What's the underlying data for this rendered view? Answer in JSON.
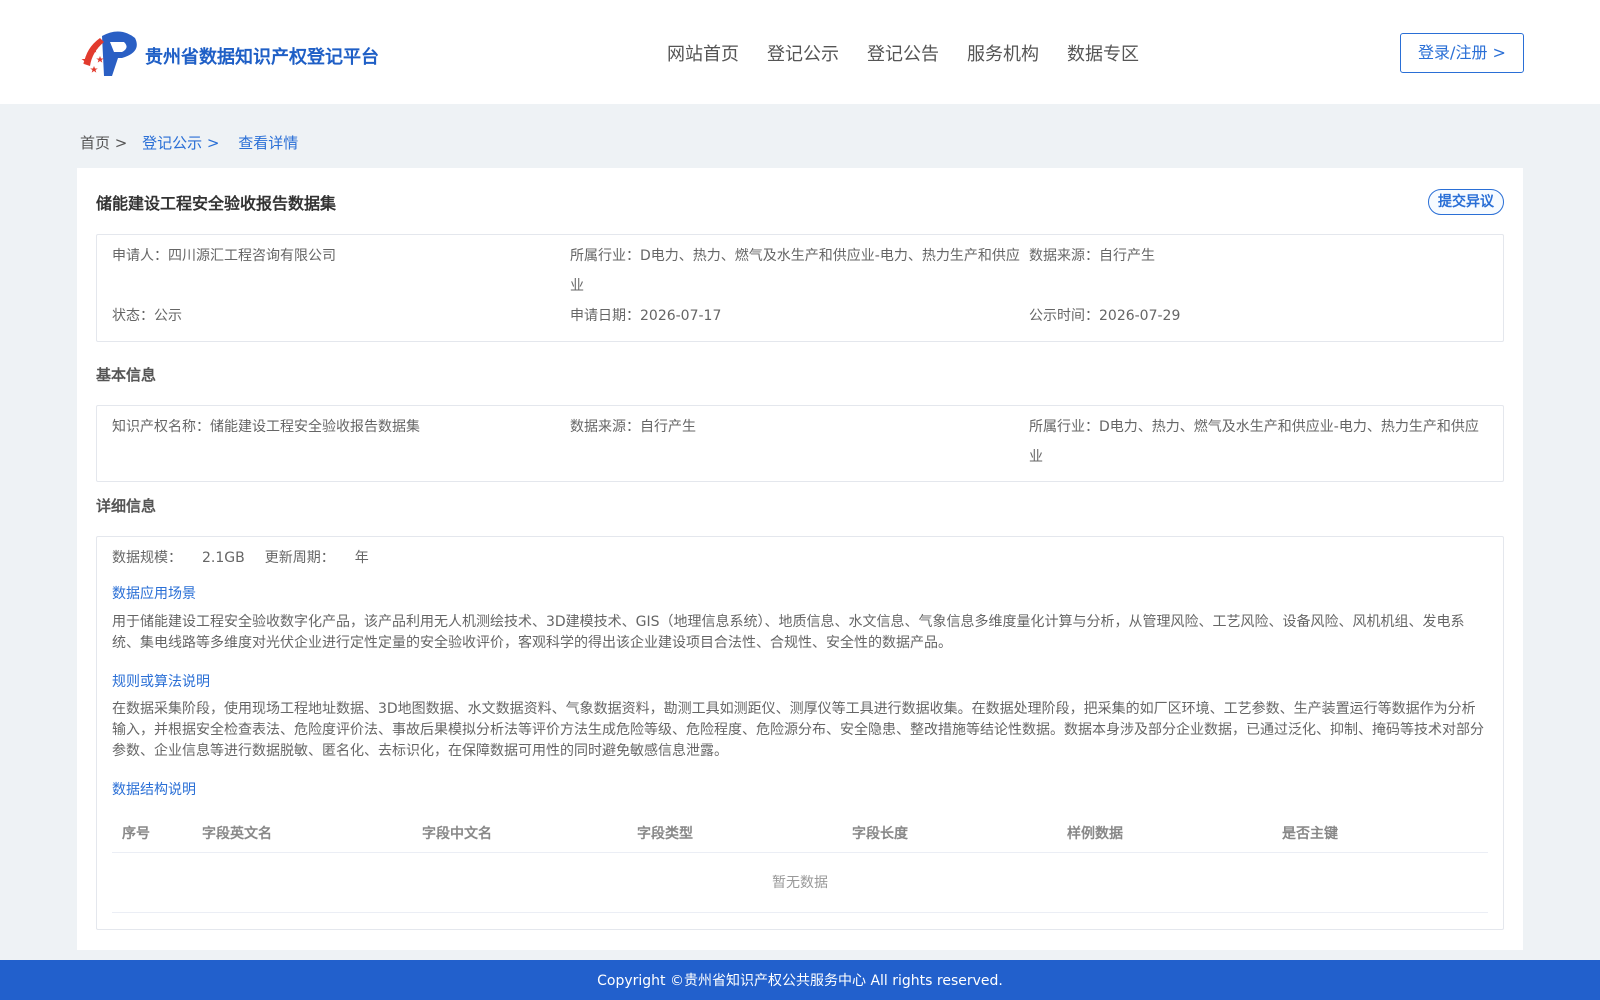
{
  "header": {
    "brand": "贵州省数据知识产权登记平台",
    "nav": [
      "网站首页",
      "登记公示",
      "登记公告",
      "服务机构",
      "数据专区"
    ],
    "login_label": "登录/注册 >"
  },
  "breadcrumb": {
    "home": "首页 >",
    "list": "登记公示 >",
    "current": "查看详情"
  },
  "detail": {
    "title": "储能建设工程安全验收报告数据集",
    "objection_label": "提交异议",
    "summary": {
      "applicant_label": "申请人：",
      "applicant": "四川源汇工程咨询有限公司",
      "industry_label": "所属行业：",
      "industry": "D电力、热力、燃气及水生产和供应业-电力、热力生产和供应业",
      "source_label": "数据来源：",
      "source": "自行产生",
      "status_label": "状态：",
      "status": "公示",
      "apply_date_label": "申请日期：",
      "apply_date": "2026-07-17",
      "publish_time_label": "公示时间：",
      "publish_time": "2026-07-29"
    },
    "basic_title": "基本信息",
    "basic": {
      "name_label": "知识产权名称：",
      "name": "储能建设工程安全验收报告数据集",
      "source_label": "数据来源：",
      "source": "自行产生",
      "industry_label": "所属行业：",
      "industry": "D电力、热力、燃气及水生产和供应业-电力、热力生产和供应业"
    },
    "detail_title": "详细信息",
    "detailed": {
      "scale_label": "数据规模：",
      "scale": "2.1GB",
      "cycle_label": "更新周期：",
      "cycle": "年",
      "scenario_title": "数据应用场景",
      "scenario_text": "用于储能建设工程安全验收数字化产品，该产品利用无人机测绘技术、3D建模技术、GIS（地理信息系统）、地质信息、水文信息、气象信息多维度量化计算与分析，从管理风险、工艺风险、设备风险、风机机组、发电系统、集电线路等多维度对光伏企业进行定性定量的安全验收评价，客观科学的得出该企业建设项目合法性、合规性、安全性的数据产品。",
      "algo_title": "规则或算法说明",
      "algo_text": "在数据采集阶段，使用现场工程地址数据、3D地图数据、水文数据资料、气象数据资料，勘测工具如测距仪、测厚仪等工具进行数据收集。在数据处理阶段，把采集的如厂区环境、工艺参数、生产装置运行等数据作为分析输入，并根据安全检查表法、危险度评价法、事故后果模拟分析法等评价方法生成危险等级、危险程度、危险源分布、安全隐患、整改措施等结论性数据。数据本身涉及部分企业数据，已通过泛化、抑制、掩码等技术对部分参数、企业信息等进行数据脱敏、匿名化、去标识化，在保障数据可用性的同时避免敏感信息泄露。",
      "structure_title": "数据结构说明",
      "columns": [
        "序号",
        "字段英文名",
        "字段中文名",
        "字段类型",
        "字段长度",
        "样例数据",
        "是否主键"
      ],
      "empty_text": "暂无数据"
    }
  },
  "footer": {
    "copyright": "Copyright ©贵州省知识产权公共服务中心 All rights reserved."
  },
  "colors": {
    "primary": "#2a6fd6",
    "footer_bg": "#2260cc",
    "page_bg": "#eef2f5"
  }
}
